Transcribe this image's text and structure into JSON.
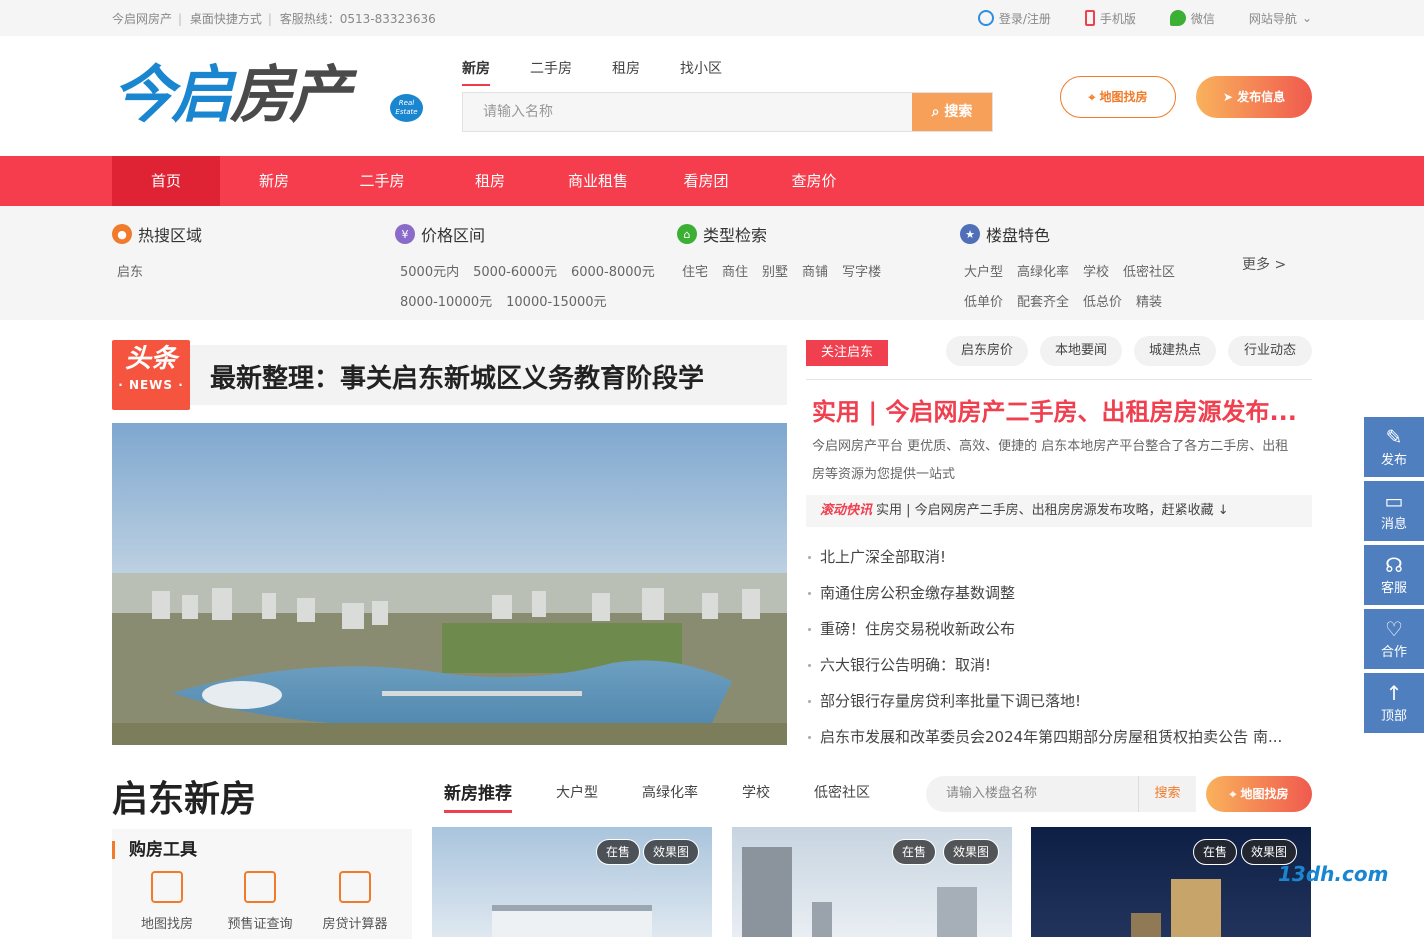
{
  "topbar": {
    "site": "今启网房产",
    "shortcut": "桌面快捷方式",
    "hotline": "客服热线：0513-83323636",
    "login": "登录/注册",
    "mobile": "手机版",
    "wechat": "微信",
    "sitenav": "网站导航"
  },
  "logo": {
    "text_a": "今启",
    "text_b": "房产",
    "badge": "Real Estate"
  },
  "search": {
    "tabs": [
      "新房",
      "二手房",
      "租房",
      "找小区"
    ],
    "placeholder": "请输入名称",
    "button": "搜索"
  },
  "header_buttons": {
    "map": "地图找房",
    "publish": "发布信息"
  },
  "nav": [
    "首页",
    "新房",
    "二手房",
    "租房",
    "商业租售",
    "看房团",
    "查房价"
  ],
  "filters": {
    "hot_area": {
      "title": "热搜区域",
      "items": [
        "启东"
      ]
    },
    "price": {
      "title": "价格区间",
      "items": [
        "5000元内",
        "5000-6000元",
        "6000-8000元",
        "8000-10000元",
        "10000-15000元"
      ]
    },
    "type": {
      "title": "类型检索",
      "items": [
        "住宅",
        "商住",
        "别墅",
        "商铺",
        "写字楼"
      ]
    },
    "feature": {
      "title": "楼盘特色",
      "items": [
        "大户型",
        "高绿化率",
        "学校",
        "低密社区",
        "低单价",
        "配套齐全",
        "低总价",
        "精装"
      ]
    },
    "more": "更多 >"
  },
  "headline": {
    "logo_top": "头条",
    "logo_bottom": "· NEWS ·",
    "title": "最新整理：事关启东新城区义务教育阶段学"
  },
  "news": {
    "tag": "关注启东",
    "pills": [
      "启东房价",
      "本地要闻",
      "城建热点",
      "行业动态"
    ],
    "title": "实用 | 今启网房产二手房、出租房房源发布...",
    "desc": "今启网房产平台 更优质、高效、便捷的 启东本地房产平台整合了各方二手房、出租房等资源为您提供一站式",
    "scroll_label": "滚动快讯",
    "scroll_text": "实用 | 今启网房产二手房、出租房房源发布攻略，赶紧收藏 ↓",
    "list": [
      "北上广深全部取消!",
      "南通住房公积金缴存基数调整",
      "重磅！住房交易税收新政公布",
      "六大银行公告明确：取消!",
      "部分银行存量房贷利率批量下调已落地!",
      "启东市发展和改革委员会2024年第四期部分房屋租赁权拍卖公告 南..."
    ]
  },
  "sidebar": [
    "发布",
    "消息",
    "客服",
    "合作",
    "顶部"
  ],
  "section": {
    "title": "启东新房",
    "tabs": [
      "新房推荐",
      "大户型",
      "高绿化率",
      "学校",
      "低密社区"
    ],
    "search_placeholder": "请输入楼盘名称",
    "search_button": "搜索",
    "map_button": "地图找房"
  },
  "tools": {
    "title": "购房工具",
    "items": [
      "地图找房",
      "预售证查询",
      "房贷计算器"
    ]
  },
  "cards": [
    {
      "status": "在售",
      "tag": "效果图"
    },
    {
      "status": "在售",
      "tag": "效果图"
    },
    {
      "status": "在售",
      "tag": "效果图"
    }
  ],
  "watermark": "13dh.com",
  "colors": {
    "brand_red": "#f53d4d",
    "brand_blue": "#1a86d0",
    "orange": "#f07b2a"
  }
}
